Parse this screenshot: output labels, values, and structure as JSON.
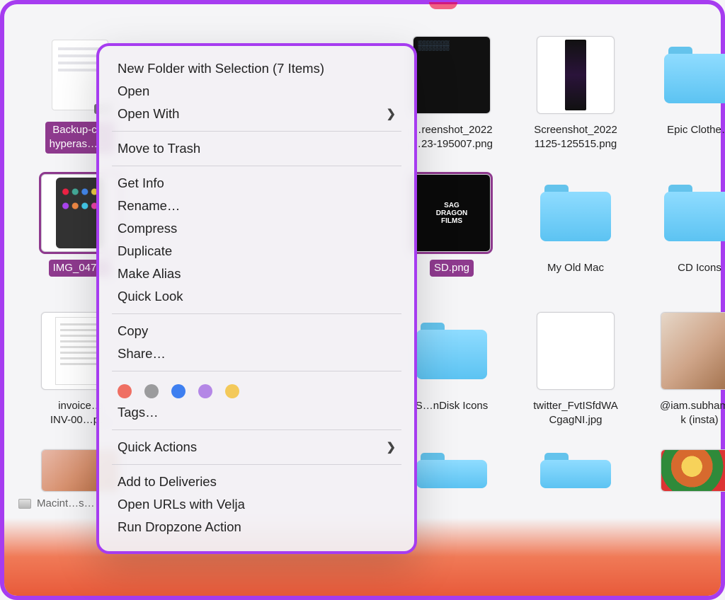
{
  "grid": {
    "r1c1": {
      "label": "Backup-c…\nhyperas…i…",
      "selected": true,
      "kind": "txt"
    },
    "r1c4": {
      "label": "…reenshot_2022\n…23-195007.png",
      "selected": false,
      "kind": "black-preview"
    },
    "r1c5": {
      "label": "Screenshot_2022\n1125-125515.png",
      "selected": false,
      "kind": "tall"
    },
    "r1c6": {
      "label": "Epic Clothe…",
      "selected": false,
      "kind": "folder"
    },
    "r2c1": {
      "label": "IMG_047…",
      "selected": true,
      "kind": "homescreen"
    },
    "r2c4": {
      "label": "SD.png",
      "selected": true,
      "kind": "sd"
    },
    "r2c5": {
      "label": "My Old Mac",
      "selected": false,
      "kind": "folder"
    },
    "r2c6": {
      "label": "CD Icons",
      "selected": false,
      "kind": "folder"
    },
    "r3c1": {
      "label": "invoice…\nINV-00…p…",
      "selected": false,
      "kind": "invoice"
    },
    "r3c4": {
      "label": "S…nDisk Icons",
      "selected": false,
      "kind": "folder"
    },
    "r3c5": {
      "label": "twitter_FvtISfdWA\nCgagNI.jpg",
      "selected": false,
      "kind": "meme"
    },
    "r3c6": {
      "label": "@iam.subham…\nk (insta)",
      "selected": false,
      "kind": "portrait"
    },
    "r4c1": {
      "label": "",
      "selected": false,
      "kind": "photo-a"
    },
    "r4c4": {
      "label": "",
      "selected": false,
      "kind": "folder"
    },
    "r4c5": {
      "label": "",
      "selected": false,
      "kind": "folder"
    },
    "r4c6": {
      "label": "",
      "selected": false,
      "kind": "salad"
    }
  },
  "sd_text_lines": {
    "l1": "SAG",
    "l2": "DRAGON",
    "l3": "FILMS"
  },
  "diskbar_label": "Macint…s…",
  "menu": {
    "new_folder": "New Folder with Selection (7 Items)",
    "open": "Open",
    "open_with": "Open With",
    "move_trash": "Move to Trash",
    "get_info": "Get Info",
    "rename": "Rename…",
    "compress": "Compress",
    "duplicate": "Duplicate",
    "make_alias": "Make Alias",
    "quick_look": "Quick Look",
    "copy": "Copy",
    "share": "Share…",
    "tags": "Tags…",
    "quick_actions": "Quick Actions",
    "add_deliveries": "Add to Deliveries",
    "open_velja": "Open URLs with Velja",
    "run_dropzone": "Run Dropzone Action"
  },
  "tag_colors": {
    "red": "#ef6f63",
    "gray": "#9b9b9d",
    "blue": "#3e7ff0",
    "purple": "#b487e6",
    "yellow": "#f3c95a"
  }
}
